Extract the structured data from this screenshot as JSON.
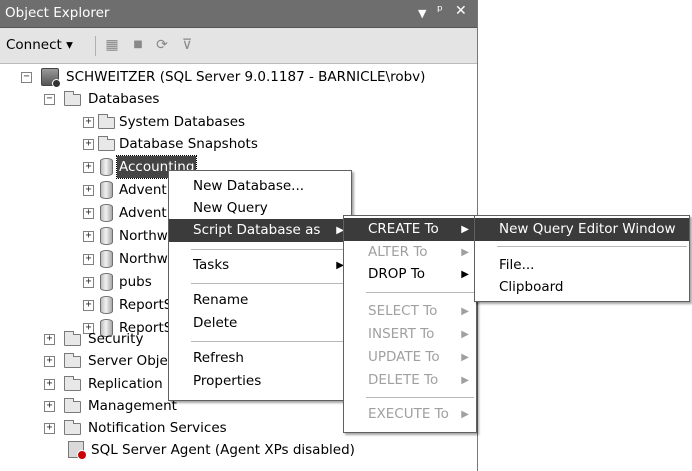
{
  "window": {
    "title": "Object Explorer",
    "controls": [
      "▾",
      "ᵖ",
      "×"
    ]
  },
  "toolbar": {
    "connect_label": "Connect ▾",
    "icons": [
      "register-server-icon",
      "stop-icon",
      "refresh-icon",
      "filter-icon"
    ]
  },
  "tree": {
    "server_label": "SCHWEITZER (SQL Server 9.0.1187 - BARNICLE\\robv)",
    "databases_label": "Databases",
    "system_databases": "System Databases",
    "database_snapshots": "Database Snapshots",
    "db_accounting": "Accounting",
    "db_advent1": "Advent",
    "db_advent2": "Advent",
    "db_northw1": "Northw",
    "db_northw2": "Northw",
    "db_pubs": "pubs",
    "db_reports1": "ReportS",
    "db_reports2": "ReportS",
    "security": "Security",
    "server_objects": "Server Obje",
    "replication": "Replication",
    "management": "Management",
    "notification_services": "Notification Services",
    "sql_agent": "SQL Server Agent (Agent XPs disabled)"
  },
  "context_menu": {
    "new_database": "New Database...",
    "new_query": "New Query",
    "script_database_as": "Script Database as",
    "tasks": "Tasks",
    "rename": "Rename",
    "delete": "Delete",
    "refresh": "Refresh",
    "properties": "Properties"
  },
  "script_submenu": {
    "create_to": "CREATE To",
    "alter_to": "ALTER To",
    "drop_to": "DROP To",
    "select_to": "SELECT To",
    "insert_to": "INSERT To",
    "update_to": "UPDATE To",
    "delete_to": "DELETE To",
    "execute_to": "EXECUTE To"
  },
  "create_submenu": {
    "new_query_editor_window": "New Query Editor Window",
    "file": "File...",
    "clipboard": "Clipboard"
  },
  "arrow_glyph": "▶",
  "colors": {
    "titlebar": "#6e6e6e",
    "highlight": "#3b3b3b",
    "disabled_text": "#a0a0a0"
  }
}
